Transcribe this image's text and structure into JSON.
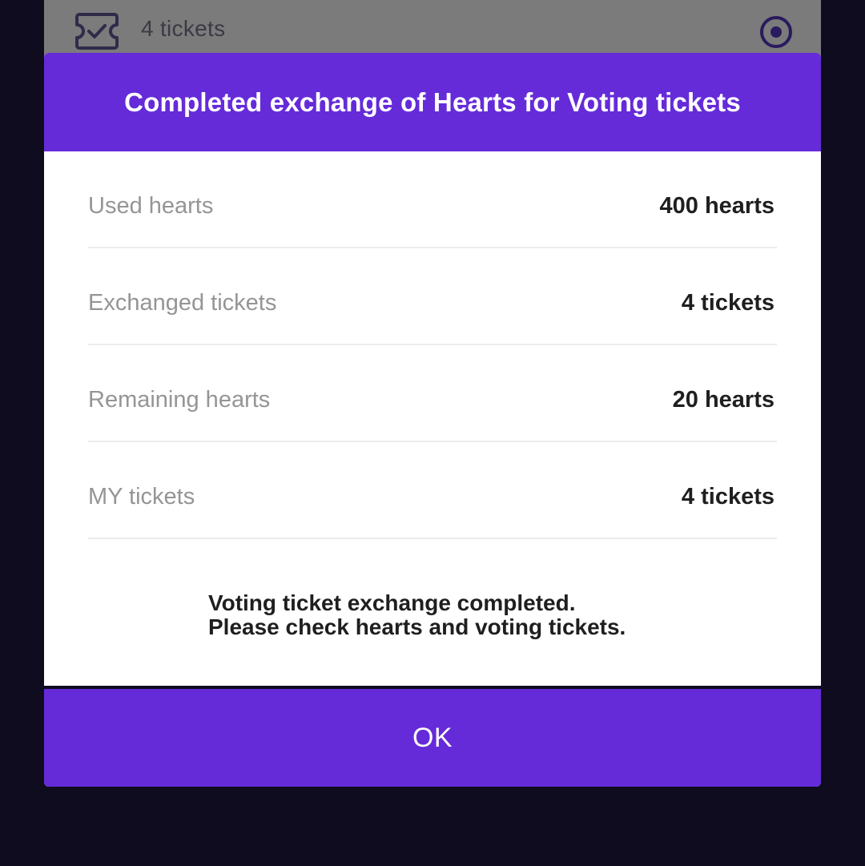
{
  "background": {
    "option_label": "4 tickets",
    "option_icon": "ticket-check-icon",
    "radio_icon": "radio-selected-icon"
  },
  "modal": {
    "title": "Completed exchange of Hearts for Voting tickets",
    "rows": [
      {
        "label": "Used hearts",
        "value": "400 hearts"
      },
      {
        "label": "Exchanged tickets",
        "value": "4 tickets"
      },
      {
        "label": "Remaining hearts",
        "value": "20 hearts"
      },
      {
        "label": "MY tickets",
        "value": "4 tickets"
      }
    ],
    "message_line1": "Voting ticket exchange completed.",
    "message_line2": "Please check hearts and voting tickets.",
    "ok_label": "OK"
  },
  "colors": {
    "accent": "#652bd9",
    "backdrop": "#0e0c1e",
    "dim_sheet": "#7b7b7b",
    "label_gray": "#959595",
    "value_dark": "#1f1f1f"
  }
}
